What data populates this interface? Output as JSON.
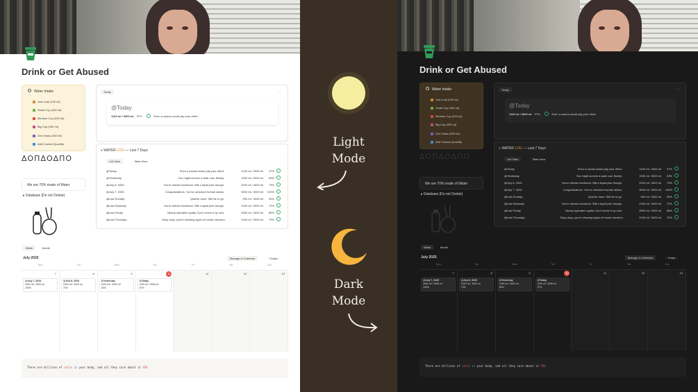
{
  "page_title": "Drink or Get Abused",
  "water_intake": {
    "title": "Water Intake",
    "items": [
      {
        "label": "Just a sip (100 ml)",
        "color": "#c98a3d"
      },
      {
        "label": "Small Cup (150 ml)",
        "color": "#6fae4b"
      },
      {
        "label": "Medium Cup (200 ml)",
        "color": "#d64a3b"
      },
      {
        "label": "Big Cup (250 ml)",
        "color": "#c64c8a"
      },
      {
        "label": "One Glass (300 ml)",
        "color": "#7a5cc4"
      },
      {
        "label": "Add Custom Quantity",
        "color": "#3e8fd1"
      }
    ],
    "doodle": "ΔΟΠΔΟΔΠΟ"
  },
  "today_card": {
    "chip": "Today",
    "heading": "@Today",
    "amount": "1100 ml / 3000 ml",
    "percent": "37%",
    "message": "Even a cactus would pity your effort."
  },
  "water_log": {
    "title_prefix": "WATER",
    "title_log": "LOG",
    "title_suffix": "— Last 7 Days",
    "tab_list": "List View",
    "tab_table": "Table View",
    "rows_light": [
      {
        "name": "@Today",
        "msg": "Even a cactus would pity your effort.",
        "ml": "1100 ml / 3000 ml",
        "pct": "37%"
      },
      {
        "name": "@Yesterday",
        "msg": "You might survive a walk now. Barely.",
        "ml": "1900 ml / 3000 ml",
        "pct": "63%"
      },
      {
        "name": "@July 8, 2025",
        "msg": "You're almost functional. Still a liquid joke though.",
        "ml": "2200 ml / 3000 ml",
        "pct": "73%"
      },
      {
        "name": "@July 7, 2025",
        "msg": "Congratulations. You've unlocked human status.",
        "ml": "3000 ml / 3000 ml",
        "pct": "100%"
      },
      {
        "name": "@Last Sunday",
        "msg": "Quarter done. Still far to go.",
        "ml": "900 ml / 3000 ml",
        "pct": "30%"
      },
      {
        "name": "@Last Saturday",
        "msg": "You're almost functional. Still a liquid joke though.",
        "ml": "2150 ml / 3000 ml",
        "pct": "72%"
      },
      {
        "name": "@Last Friday",
        "msg": "Nearly hydrated royalty. Don't screw it up now.",
        "ml": "2550 ml / 3000 ml",
        "pct": "85%"
      },
      {
        "name": "@Last Thursday",
        "msg": "Okay okay, you're showing signs of human function.",
        "ml": "2100 ml / 3000 ml",
        "pct": "70%"
      }
    ],
    "rows_dark": [
      {
        "name": "@Today",
        "msg": "Even a cactus would pity your effort.",
        "ml": "1100 ml / 3000 ml",
        "pct": "37%"
      },
      {
        "name": "@Yesterday",
        "msg": "You might survive a walk now. Barely.",
        "ml": "1900 ml / 3000 ml",
        "pct": "63%"
      },
      {
        "name": "@July 8, 2025",
        "msg": "You're almost functional. Still a liquid joke though.",
        "ml": "2200 ml / 3000 ml",
        "pct": "73%"
      },
      {
        "name": "@July 7, 2025",
        "msg": "Congratulations. You've unlocked human status.",
        "ml": "3000 ml / 3000 ml",
        "pct": "100%"
      },
      {
        "name": "@Last Sunday",
        "msg": "Quarter done. Still far to go.",
        "ml": "900 ml / 3000 ml",
        "pct": "30%"
      },
      {
        "name": "@Last Saturday",
        "msg": "You're almost functional. Still a liquid joke though.",
        "ml": "2150 ml / 3000 ml",
        "pct": "72%"
      },
      {
        "name": "@Last Friday",
        "msg": "Nearly hydrated royalty. Don't screw it up now.",
        "ml": "2550 ml / 3000 ml",
        "pct": "85%"
      },
      {
        "name": "@Last Thursday",
        "msg": "Okay okay, you're showing signs of human function.",
        "ml": "2100 ml / 3000 ml",
        "pct": "70%"
      }
    ]
  },
  "callout": "We are 70% made of Water",
  "database_toggle": "Database [Do not Delete]",
  "calendar": {
    "tab_week": "Week",
    "tab_month": "Month",
    "month": "July 2025",
    "manage": "Manage in Calendar",
    "today_btn": "Today",
    "weekdays": [
      "Mon",
      "Tue",
      "Wed",
      "Thu",
      "Fri",
      "Sat",
      "Sun"
    ],
    "days": [
      "7",
      "8",
      "9",
      "10",
      "11",
      "12",
      "13"
    ],
    "events": [
      {
        "name": "@July 7, 2025",
        "ml": "3000 ml / 3000 ml",
        "pct": "100%"
      },
      {
        "name": "@July 8, 2025",
        "ml": "2200 ml / 3000 ml",
        "pct": "73%"
      },
      {
        "name": "@Yesterday",
        "ml": "1900 ml / 3000 ml",
        "pct": "63%"
      },
      {
        "name": "@Today",
        "ml": "1100 ml / 3000 ml",
        "pct": "37%"
      }
    ]
  },
  "quote": {
    "pre": "There are billions of",
    "w1": "cells",
    "mid1": "in",
    "mid2": "your body, and all they care about is",
    "w2": "YOU"
  },
  "modes": {
    "light": "Light\nMode",
    "dark": "Dark\nMode"
  },
  "colors": {
    "mid_bg": "#3a2f25",
    "sun": "#f5eea0",
    "moon": "#f6b53d",
    "accent_green": "#3aa56b"
  }
}
